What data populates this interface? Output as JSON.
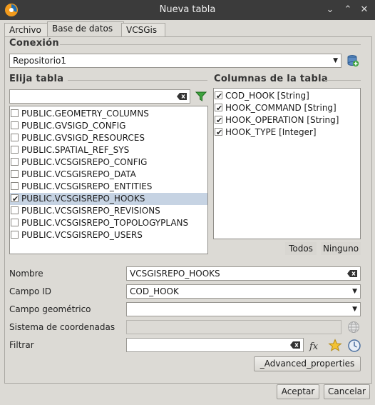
{
  "window": {
    "title": "Nueva tabla"
  },
  "tabs": [
    {
      "label": "Archivo"
    },
    {
      "label": "Base de datos"
    },
    {
      "label": "VCSGis"
    }
  ],
  "connection": {
    "label": "Conexión",
    "value": "Repositorio1"
  },
  "tables": {
    "label": "Elija tabla",
    "filter_value": "",
    "items": [
      {
        "label": "PUBLIC.GEOMETRY_COLUMNS",
        "checked": false
      },
      {
        "label": "PUBLIC.GVSIGD_CONFIG",
        "checked": false
      },
      {
        "label": "PUBLIC.GVSIGD_RESOURCES",
        "checked": false
      },
      {
        "label": "PUBLIC.SPATIAL_REF_SYS",
        "checked": false
      },
      {
        "label": "PUBLIC.VCSGISREPO_CONFIG",
        "checked": false
      },
      {
        "label": "PUBLIC.VCSGISREPO_DATA",
        "checked": false
      },
      {
        "label": "PUBLIC.VCSGISREPO_ENTITIES",
        "checked": false
      },
      {
        "label": "PUBLIC.VCSGISREPO_HOOKS",
        "checked": true,
        "selected": true
      },
      {
        "label": "PUBLIC.VCSGISREPO_REVISIONS",
        "checked": false
      },
      {
        "label": "PUBLIC.VCSGISREPO_TOPOLOGYPLANS",
        "checked": false
      },
      {
        "label": "PUBLIC.VCSGISREPO_USERS",
        "checked": false
      }
    ]
  },
  "columns": {
    "label": "Columnas de la tabla",
    "items": [
      {
        "label": "COD_HOOK [String]",
        "checked": true
      },
      {
        "label": "HOOK_COMMAND [String]",
        "checked": true
      },
      {
        "label": "HOOK_OPERATION [String]",
        "checked": true
      },
      {
        "label": "HOOK_TYPE [Integer]",
        "checked": true
      }
    ],
    "all_label": "Todos",
    "none_label": "Ninguno"
  },
  "form": {
    "name_label": "Nombre",
    "name_value": "VCSGISREPO_HOOKS",
    "id_label": "Campo ID",
    "id_value": "COD_HOOK",
    "geom_label": "Campo geométrico",
    "geom_value": "",
    "srs_label": "Sistema de coordenadas",
    "srs_value": "",
    "filter_label": "Filtrar",
    "filter_value": "",
    "advanced_label": "_Advanced_properties"
  },
  "footer": {
    "accept_label": "Aceptar",
    "cancel_label": "Cancelar"
  },
  "colors": {
    "titlebar": "#3b3b3b",
    "background": "#dcdad5",
    "selection": "#c6d3e3"
  }
}
